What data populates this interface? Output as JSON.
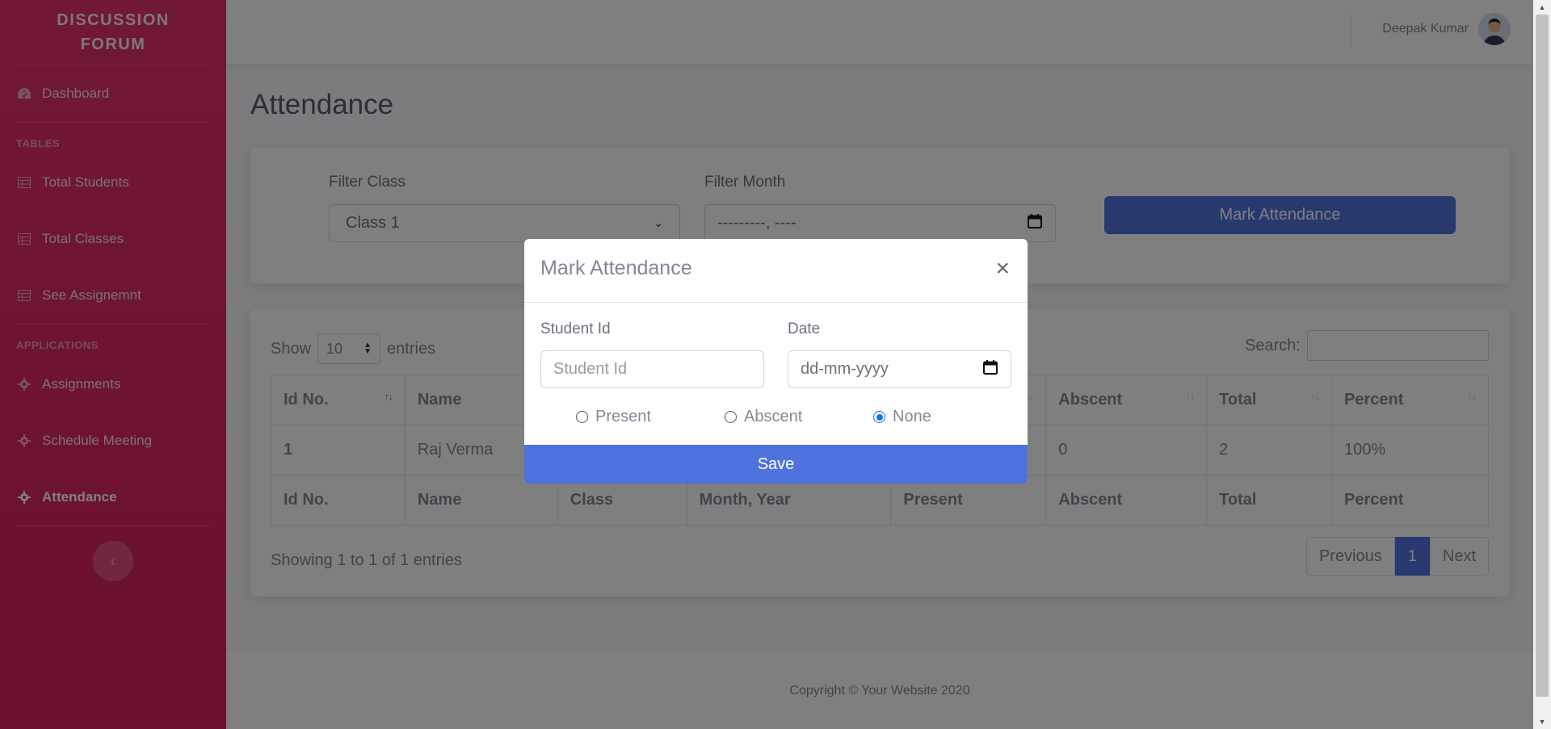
{
  "sidebar": {
    "brand": "DISCUSSION FORUM",
    "items": [
      {
        "label": "Dashboard",
        "icon": "dashboard-icon"
      },
      {
        "section": "TABLES"
      },
      {
        "label": "Total Students",
        "icon": "table-icon"
      },
      {
        "label": "Total Classes",
        "icon": "table-icon"
      },
      {
        "label": "See Assignemnt",
        "icon": "table-icon"
      },
      {
        "section": "APPLICATIONS"
      },
      {
        "label": "Assignments",
        "icon": "gear-icon"
      },
      {
        "label": "Schedule Meeting",
        "icon": "gear-icon"
      },
      {
        "label": "Attendance",
        "icon": "gear-icon",
        "active": true
      }
    ],
    "toggle_icon": "chevron-left-icon",
    "color": "#e0245e"
  },
  "topbar": {
    "user_name": "Deepak Kumar"
  },
  "page": {
    "title": "Attendance"
  },
  "filters": {
    "class_label": "Filter Class",
    "class_value": "Class 1",
    "month_label": "Filter Month",
    "month_placeholder": "---------, ----",
    "mark_button": "Mark Attendance"
  },
  "table": {
    "show_label": "Show",
    "entries_value": "10",
    "entries_label": "entries",
    "search_label": "Search:",
    "columns": [
      "Id No.",
      "Name",
      "Class",
      "Month, Year",
      "Present",
      "Abscent",
      "Total",
      "Percent"
    ],
    "rows": [
      [
        "1",
        "Raj Verma",
        "",
        "",
        "",
        "0",
        "2",
        "100%"
      ]
    ],
    "info": "Showing 1 to 1 of 1 entries",
    "pagination": {
      "previous": "Previous",
      "current": "1",
      "next": "Next"
    }
  },
  "footer": {
    "text": "Copyright © Your Website 2020"
  },
  "modal": {
    "title": "Mark Attendance",
    "close": "×",
    "student_id_label": "Student Id",
    "student_id_placeholder": "Student Id",
    "date_label": "Date",
    "date_placeholder": "dd-mm-yyyy",
    "options": [
      {
        "label": "Present",
        "checked": false
      },
      {
        "label": "Abscent",
        "checked": false
      },
      {
        "label": "None",
        "checked": true
      }
    ],
    "save": "Save"
  },
  "colors": {
    "accent": "#4e73df",
    "sidebar": "#e0245e"
  }
}
